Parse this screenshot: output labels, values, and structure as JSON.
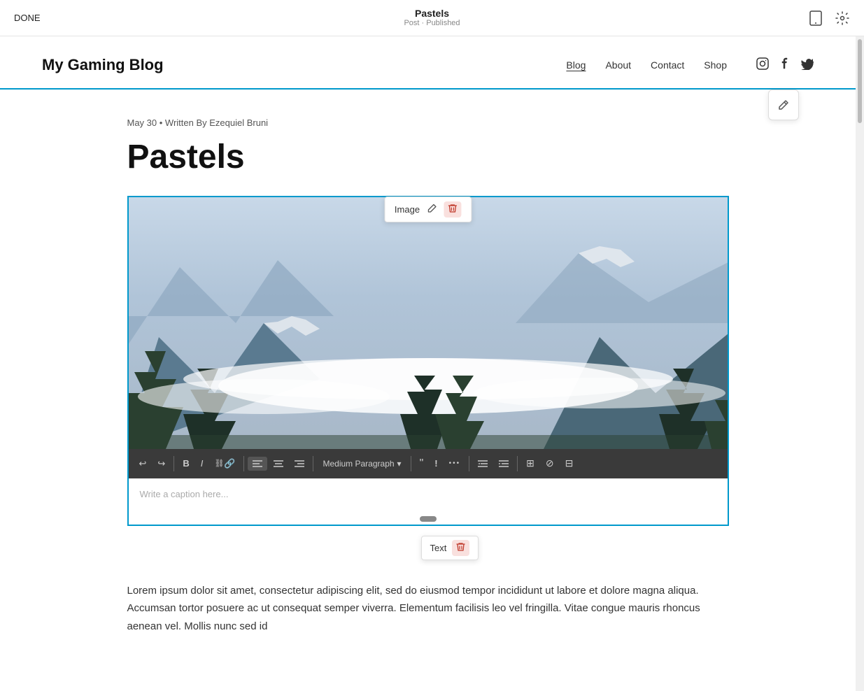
{
  "topbar": {
    "done_label": "DONE",
    "post_title": "Pastels",
    "post_status": "Post · Published",
    "device_icon": "device-icon",
    "settings_icon": "gear-icon"
  },
  "sitenav": {
    "site_title": "My Gaming Blog",
    "links": [
      {
        "label": "Blog",
        "active": true
      },
      {
        "label": "About",
        "active": false
      },
      {
        "label": "Contact",
        "active": false
      },
      {
        "label": "Shop",
        "active": false
      }
    ],
    "social": [
      "instagram-icon",
      "facebook-icon",
      "twitter-icon"
    ]
  },
  "post": {
    "meta": "May 30  •  Written By Ezequiel Bruni",
    "title": "Pastels",
    "image_toolbar": {
      "label": "Image",
      "edit_label": "✏",
      "delete_label": "🗑"
    },
    "caption_placeholder": "Write a caption here...",
    "text_toolbar": {
      "paragraph_label": "Medium Paragraph"
    },
    "text_popup": {
      "label": "Text",
      "delete_label": "🗑"
    },
    "body_text": "Lorem ipsum dolor sit amet, consectetur adipiscing elit, sed do eiusmod tempor incididunt ut labore et dolore magna aliqua. Accumsan tortor posuere ac ut consequat semper viverra. Elementum facilisis leo vel fringilla. Vitae congue mauris rhoncus aenean vel. Mollis nunc sed id"
  },
  "colors": {
    "accent": "#0099cc",
    "delete_red": "#c0392b",
    "delete_bg": "#f9e0de"
  }
}
